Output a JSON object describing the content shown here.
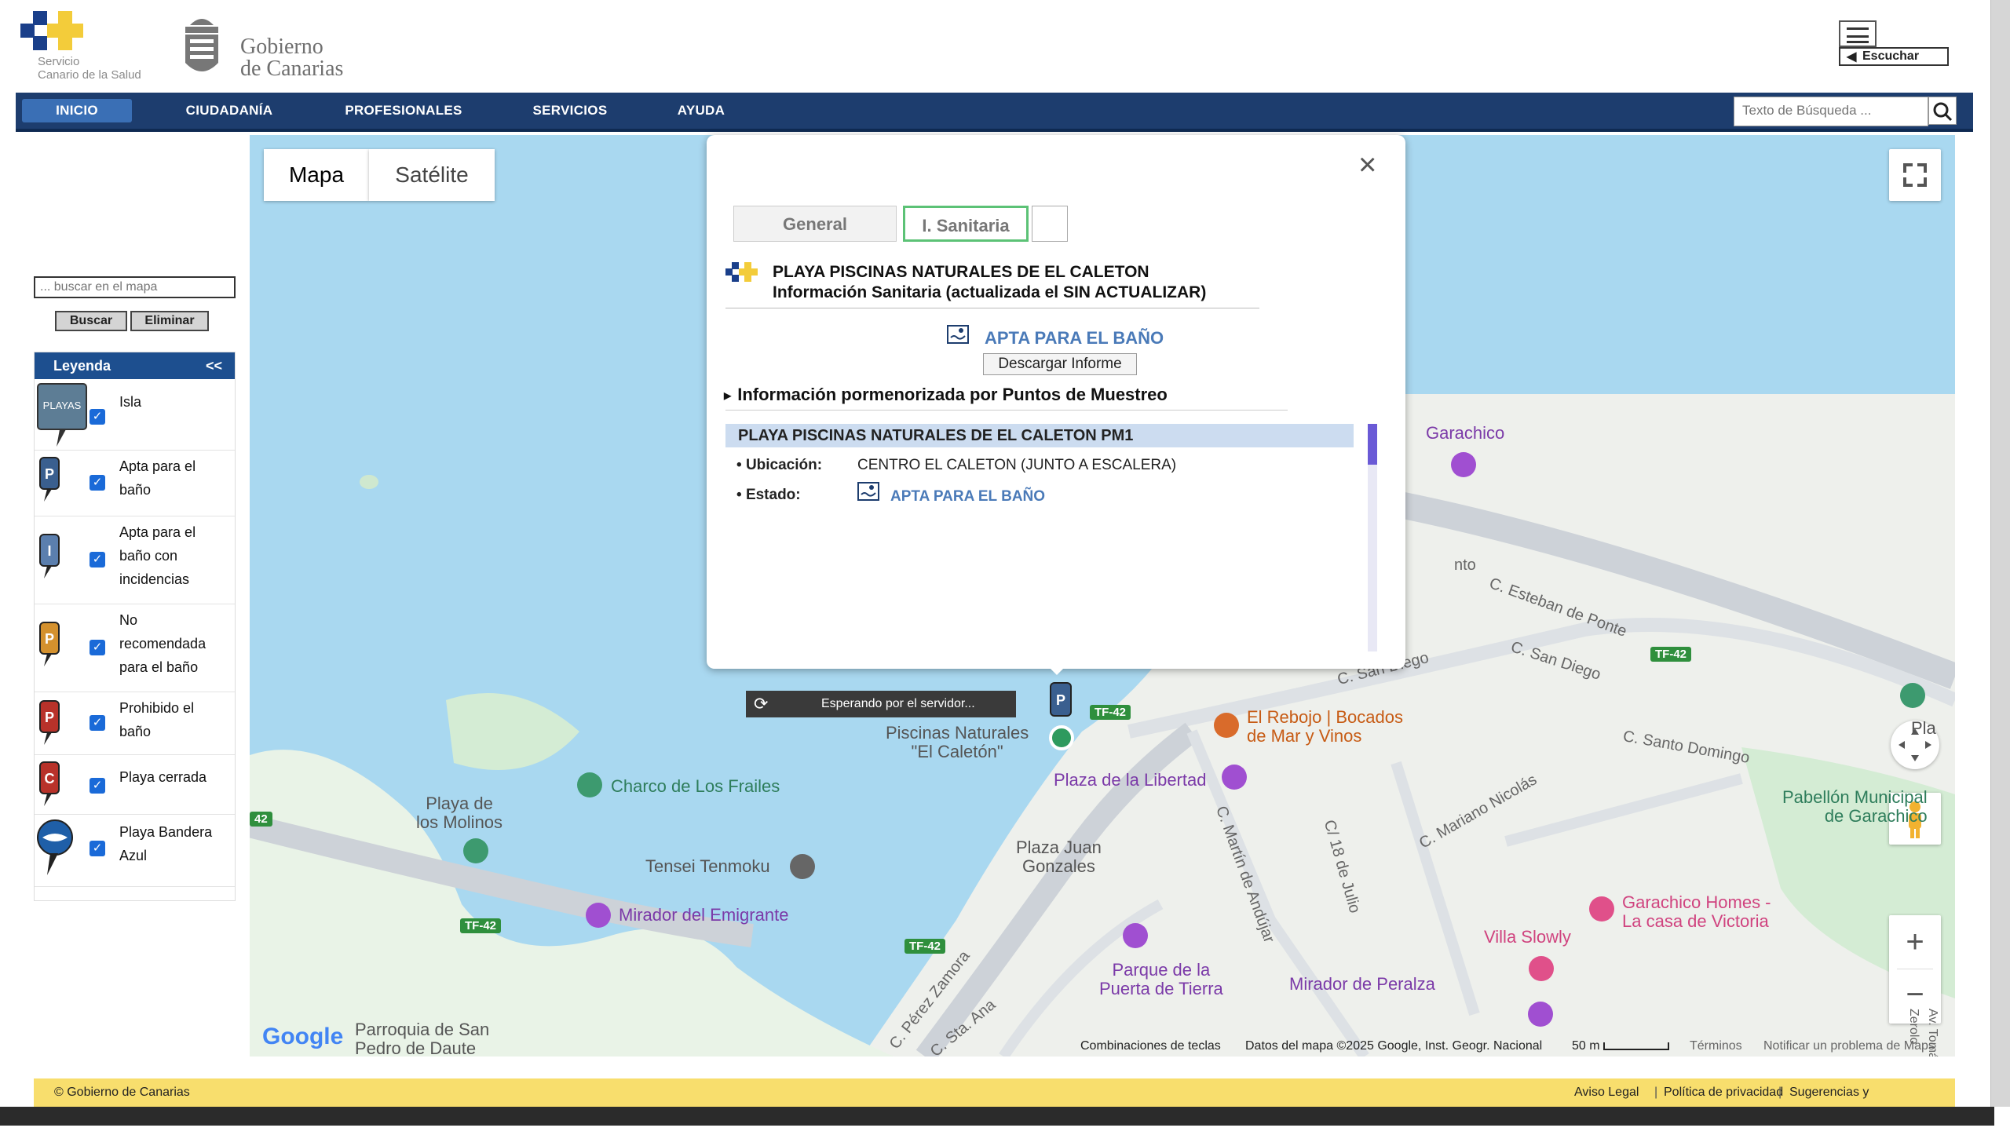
{
  "header": {
    "sns_logo_text": [
      "Servicio",
      "Canario de la Salud"
    ],
    "gob_logo_text": [
      "Gobierno",
      "de Canarias"
    ],
    "escuchar_label": "Escuchar",
    "search_placeholder": "Texto de Búsqueda ..."
  },
  "nav": {
    "items": [
      {
        "label": "INICIO",
        "active": true
      },
      {
        "label": "CIUDADANÍA"
      },
      {
        "label": "PROFESIONALES"
      },
      {
        "label": "SERVICIOS"
      },
      {
        "label": "AYUDA"
      }
    ]
  },
  "sidebar": {
    "search_placeholder": "... buscar en el mapa",
    "buscar_label": "Buscar",
    "eliminar_label": "Eliminar",
    "legend_title": "Leyenda",
    "legend_collapse": "<<",
    "legend_items": [
      {
        "label": [
          "Isla"
        ],
        "icon": "playas-island-icon",
        "checked": true
      },
      {
        "label": [
          "Apta para el",
          "baño"
        ],
        "icon": "pin-apta-icon",
        "color": "#3a5f8f",
        "letter": "P",
        "checked": true
      },
      {
        "label": [
          "Apta para el",
          "baño con",
          "incidencias"
        ],
        "icon": "pin-incidencias-icon",
        "color": "#5b7fae",
        "letter": "I",
        "checked": true
      },
      {
        "label": [
          "No",
          "recomendada",
          "para el baño"
        ],
        "icon": "pin-no-recomendada-icon",
        "color": "#d4912e",
        "letter": "P",
        "checked": true
      },
      {
        "label": [
          "Prohibido el",
          "baño"
        ],
        "icon": "pin-prohibido-icon",
        "color": "#b8322a",
        "letter": "P",
        "checked": true
      },
      {
        "label": [
          "Playa cerrada"
        ],
        "icon": "pin-cerrada-icon",
        "color": "#b8322a",
        "letter": "C",
        "checked": true
      },
      {
        "label": [
          "Playa Bandera",
          "Azul"
        ],
        "icon": "bandera-azul-icon",
        "checked": true
      }
    ]
  },
  "map": {
    "type_buttons": [
      "Mapa",
      "Satélite"
    ],
    "active_type": "Mapa",
    "labels": {
      "garachico": "Garachico",
      "nto": "nto",
      "esteban": "C. Esteban de Ponte",
      "san_diego1": "C. San Diego",
      "san_diego2": "C. San Diego",
      "santo_domingo": "C. Santo Domingo",
      "mariano": "C. Mariano Nicolás",
      "piscinas": [
        "Piscinas Naturales",
        "\"El Caletón\""
      ],
      "rebojo": [
        "El Rebojo | Bocados",
        "de Mar y Vinos"
      ],
      "plaza_libertad": "Plaza de la Libertad",
      "charco": "Charco de Los Frailes",
      "molinos": [
        "Playa de",
        "los Molinos"
      ],
      "tensei": "Tensei Tenmoku",
      "mirador_emigrante": "Mirador del Emigrante",
      "plaza_juan": [
        "Plaza Juan",
        "Gonzales"
      ],
      "martin": "C. Martín de Andújar",
      "julio": "C/ 18 de Julio",
      "pabellon": [
        "Pabellón Municipal",
        "de Garachico"
      ],
      "pla": "Pla",
      "homes": [
        "Garachico Homes -",
        "La casa de Victoria"
      ],
      "slowly": "Villa Slowly",
      "puerta": [
        "Parque de la",
        "Puerta de Tierra"
      ],
      "peralza": "Mirador de Peralza",
      "perez": "C. Pérez Zamora",
      "sta_ana": "C. Sta. Ana",
      "parroquia": [
        "Parroquia de San",
        "Pedro de Daute"
      ],
      "vertical": "Av. Tomás Zerolo"
    },
    "road_badges": [
      "TF-42",
      "TF-42",
      "TF-42",
      "TF-42",
      "42"
    ],
    "footer": {
      "keyboard": "Combinaciones de teclas",
      "data": "Datos del mapa ©2025 Google, Inst. Geogr. Nacional",
      "scale": "50 m",
      "terms": "Términos",
      "report": "Notificar un problema de Maps"
    },
    "google_logo": "Google"
  },
  "popup": {
    "tabs": [
      "General",
      "I. Sanitaria",
      ""
    ],
    "active_tab": "I. Sanitaria",
    "title": "PLAYA PISCINAS NATURALES DE EL CALETON",
    "subtitle": "Información Sanitaria (actualizada el  SIN ACTUALIZAR)",
    "status": "APTA PARA EL BAÑO",
    "download_label": "Descargar Informe",
    "section_title": "Información pormenorizada por Puntos de Muestreo",
    "point_title": "PLAYA PISCINAS NATURALES DE EL CALETON PM1",
    "ubicacion_label": "Ubicación:",
    "ubicacion_value": "CENTRO EL CALETON (JUNTO A ESCALERA)",
    "estado_label": "Estado:",
    "estado_value": "APTA PARA EL BAÑO"
  },
  "waiting_text": "Esperando por el servidor...",
  "footer": {
    "copyright": "© Gobierno de Canarias",
    "links": [
      "Aviso Legal",
      "Política de privacidad",
      "Sugerencias y Reclamaciones"
    ]
  },
  "colors": {
    "nav_bg": "#1d3d6e",
    "legend_head": "#1d4f8f",
    "water": "#a9d8f0",
    "footer_bg": "#f8de6d",
    "status_blue": "#4a7ab8"
  }
}
